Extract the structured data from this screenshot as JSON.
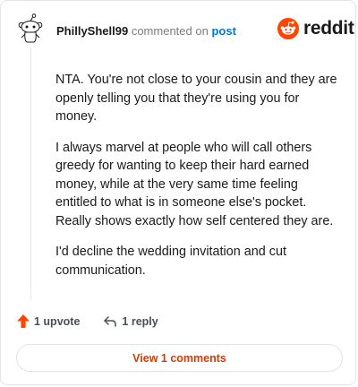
{
  "comment": {
    "username": "PhillyShell99",
    "action_text": "commented on",
    "target_link": "post",
    "avatar_icon": "snoo-avatar-icon",
    "paragraphs": [
      "NTA. You're not close to your cousin and they are openly telling you that they're using you for money.",
      "I always marvel at people who will call others greedy for wanting to keep their hard earned money, while at the very same time feeling entitled to what is in someone else's pocket. Really shows exactly how self centered they are.",
      "I'd decline the wedding invitation and cut communication."
    ]
  },
  "brand": {
    "name": "reddit",
    "color": "#ff4500"
  },
  "actions": {
    "upvote_label": "1 upvote",
    "upvote_icon": "upvote-arrow-icon",
    "reply_label": "1 reply",
    "reply_icon": "reply-arrow-icon"
  },
  "view_comments_label": "View 1 comments",
  "colors": {
    "link": "#0079d3",
    "accent": "#d93a00"
  }
}
